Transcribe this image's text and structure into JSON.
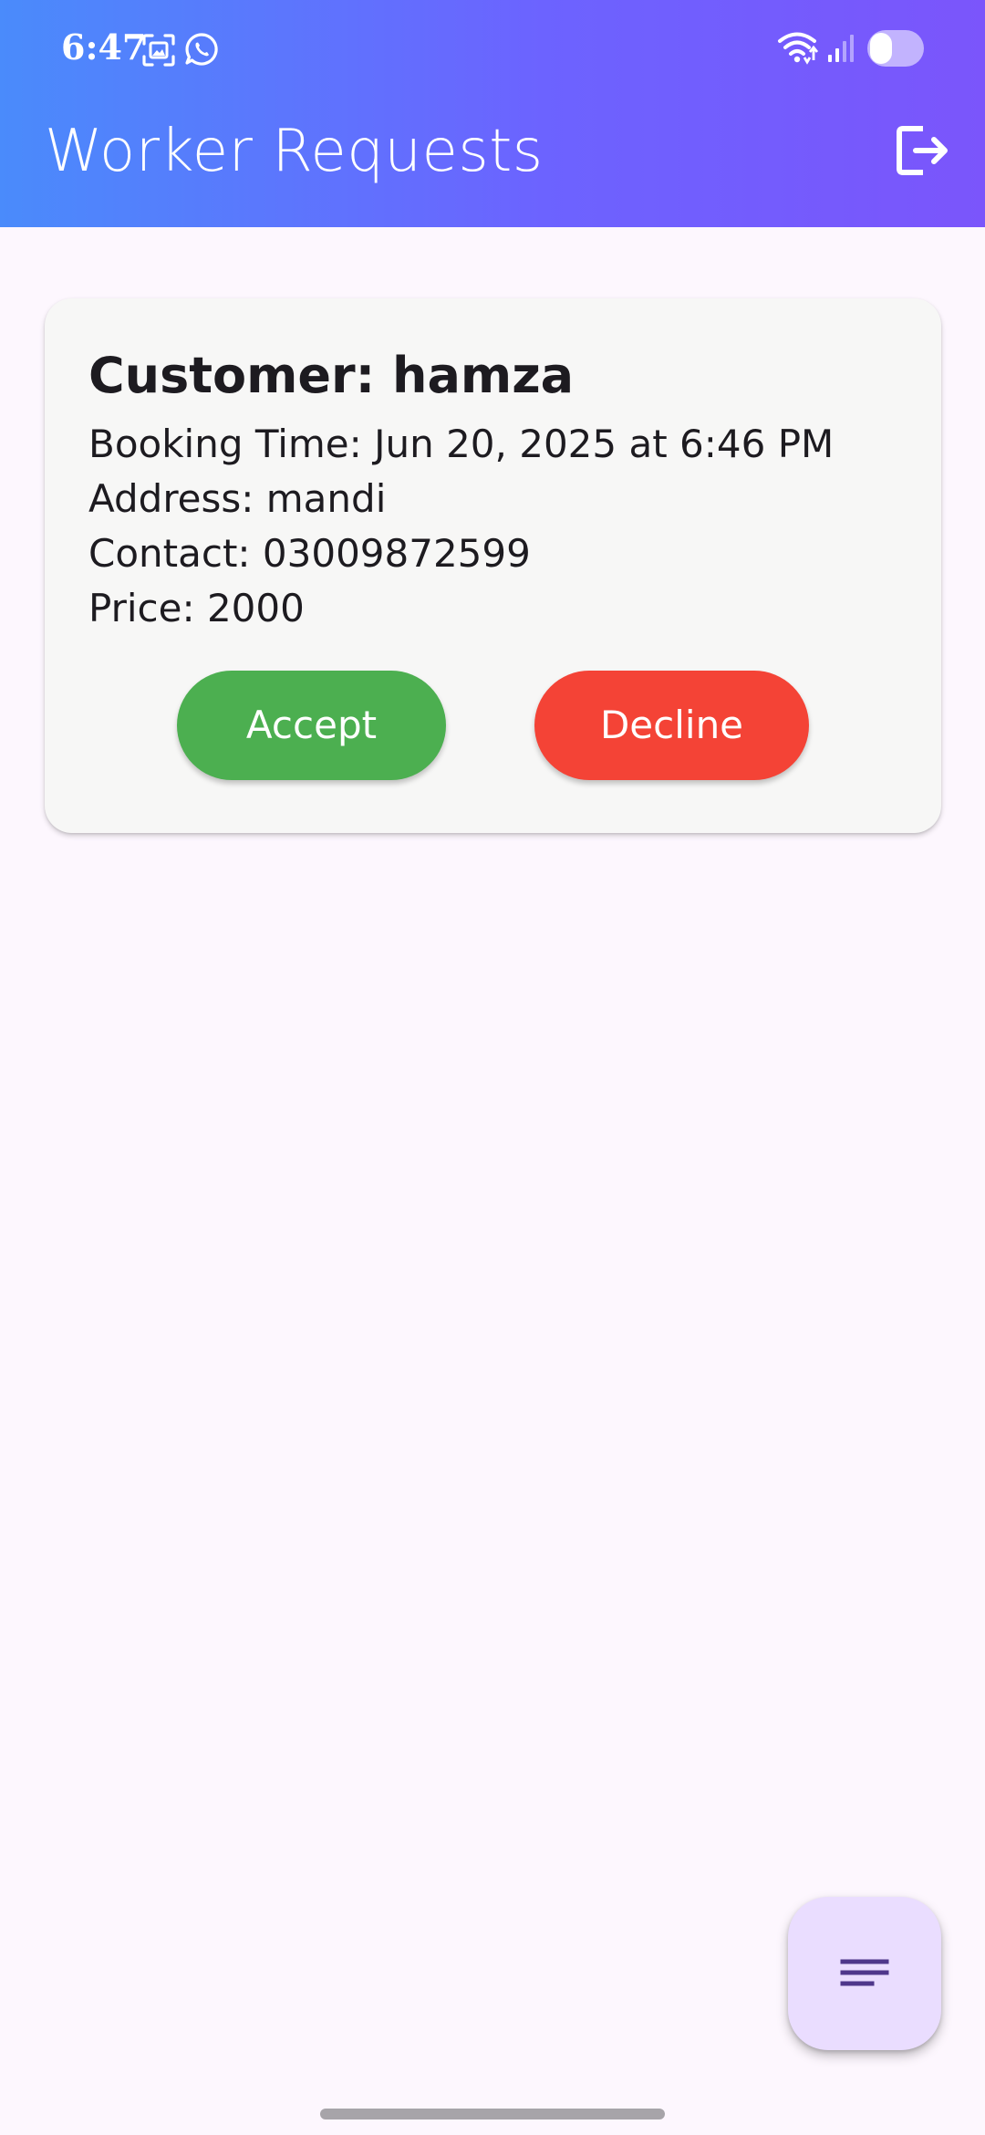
{
  "status_bar": {
    "time": "6:47",
    "icons": [
      "screenshot-icon",
      "whatsapp-icon",
      "wifi-icon",
      "signal-icon",
      "toggle-icon"
    ]
  },
  "app_bar": {
    "title": "Worker Requests",
    "action_icon": "logout-icon"
  },
  "request": {
    "customer": "Customer: hamza",
    "booking_time": "Booking Time: Jun 20, 2025 at 6:46 PM",
    "address": "Address: mandi",
    "contact": "Contact: 03009872599",
    "price": "Price: 2000",
    "accept_label": "Accept",
    "decline_label": "Decline"
  },
  "fab": {
    "icon": "menu-lines-icon"
  },
  "colors": {
    "gradient_start": "#4A8BFB",
    "gradient_end": "#7B55FB",
    "background": "#FDF7FE",
    "card": "#F7F7F6",
    "accept": "#4CAF50",
    "decline": "#F44336",
    "fab": "#EADDFF",
    "fab_icon": "#4F378B"
  }
}
